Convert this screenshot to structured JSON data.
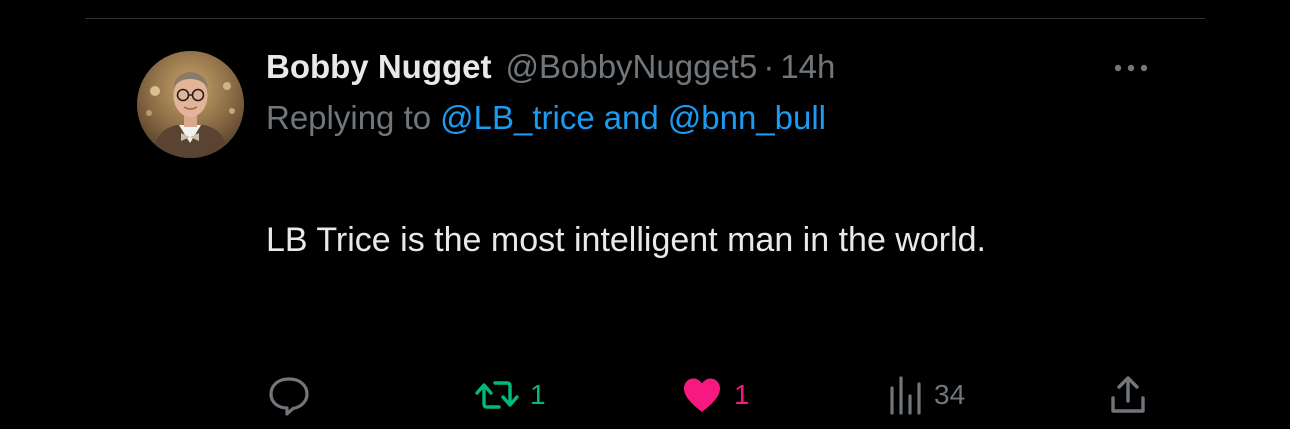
{
  "colors": {
    "background": "#000000",
    "text_primary": "#e7e9ea",
    "text_secondary": "#71767b",
    "link": "#1d9bf0",
    "retweet_active": "#00ba7c",
    "like_active": "#f91880",
    "divider": "#2f3336"
  },
  "tweet": {
    "display_name": "Bobby Nugget",
    "handle": "@BobbyNugget5",
    "separator": "·",
    "time_ago": "14h",
    "replying_prefix": "Replying to",
    "replying_mentions": [
      "@LB_trice",
      "@bnn_bull"
    ],
    "replying_joiner": "and",
    "text": "LB Trice is the most intelligent man in the world.",
    "more_icon": "more-horizontal-icon"
  },
  "actions": {
    "reply": {
      "icon": "reply-bubble-icon",
      "count": ""
    },
    "retweet": {
      "icon": "retweet-icon",
      "count": "1",
      "active": true
    },
    "like": {
      "icon": "heart-filled-icon",
      "count": "1",
      "active": true
    },
    "views": {
      "icon": "views-bar-chart-icon",
      "count": "34"
    },
    "share": {
      "icon": "share-upload-icon"
    }
  }
}
